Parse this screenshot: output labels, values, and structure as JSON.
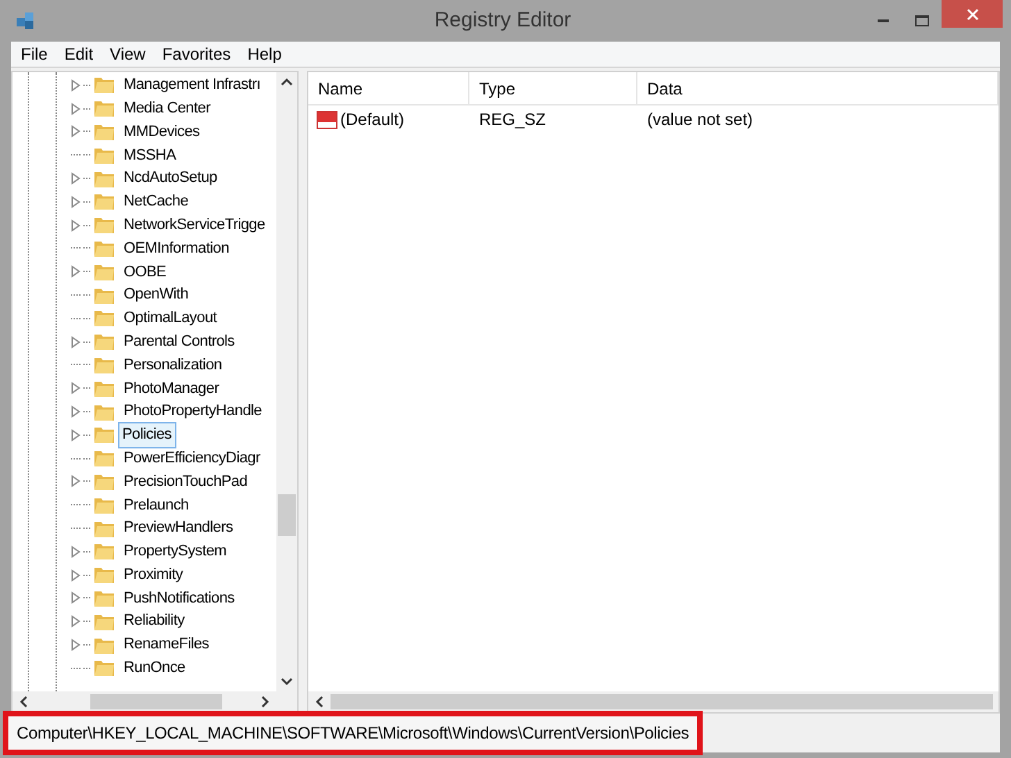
{
  "window": {
    "title": "Registry Editor"
  },
  "menu": [
    "File",
    "Edit",
    "View",
    "Favorites",
    "Help"
  ],
  "tree": [
    {
      "label": "Management Infrastrı",
      "expandable": true,
      "selected": false
    },
    {
      "label": "Media Center",
      "expandable": true,
      "selected": false
    },
    {
      "label": "MMDevices",
      "expandable": true,
      "selected": false
    },
    {
      "label": "MSSHA",
      "expandable": false,
      "selected": false
    },
    {
      "label": "NcdAutoSetup",
      "expandable": true,
      "selected": false
    },
    {
      "label": "NetCache",
      "expandable": true,
      "selected": false
    },
    {
      "label": "NetworkServiceTrigge",
      "expandable": true,
      "selected": false
    },
    {
      "label": "OEMInformation",
      "expandable": false,
      "selected": false
    },
    {
      "label": "OOBE",
      "expandable": true,
      "selected": false
    },
    {
      "label": "OpenWith",
      "expandable": false,
      "selected": false
    },
    {
      "label": "OptimalLayout",
      "expandable": false,
      "selected": false
    },
    {
      "label": "Parental Controls",
      "expandable": true,
      "selected": false
    },
    {
      "label": "Personalization",
      "expandable": false,
      "selected": false
    },
    {
      "label": "PhotoManager",
      "expandable": true,
      "selected": false
    },
    {
      "label": "PhotoPropertyHandle",
      "expandable": true,
      "selected": false
    },
    {
      "label": "Policies",
      "expandable": true,
      "selected": true
    },
    {
      "label": "PowerEfficiencyDiagr",
      "expandable": false,
      "selected": false
    },
    {
      "label": "PrecisionTouchPad",
      "expandable": true,
      "selected": false
    },
    {
      "label": "Prelaunch",
      "expandable": false,
      "selected": false
    },
    {
      "label": "PreviewHandlers",
      "expandable": false,
      "selected": false
    },
    {
      "label": "PropertySystem",
      "expandable": true,
      "selected": false
    },
    {
      "label": "Proximity",
      "expandable": true,
      "selected": false
    },
    {
      "label": "PushNotifications",
      "expandable": true,
      "selected": false
    },
    {
      "label": "Reliability",
      "expandable": true,
      "selected": false
    },
    {
      "label": "RenameFiles",
      "expandable": true,
      "selected": false
    },
    {
      "label": "RunOnce",
      "expandable": false,
      "selected": false
    }
  ],
  "table": {
    "columns": [
      "Name",
      "Type",
      "Data"
    ],
    "rows": [
      {
        "name": "(Default)",
        "type": "REG_SZ",
        "data": "(value not set)"
      }
    ]
  },
  "status_bar": {
    "path": "Computer\\HKEY_LOCAL_MACHINE\\SOFTWARE\\Microsoft\\Windows\\CurrentVersion\\Policies",
    "highlighted": true
  }
}
